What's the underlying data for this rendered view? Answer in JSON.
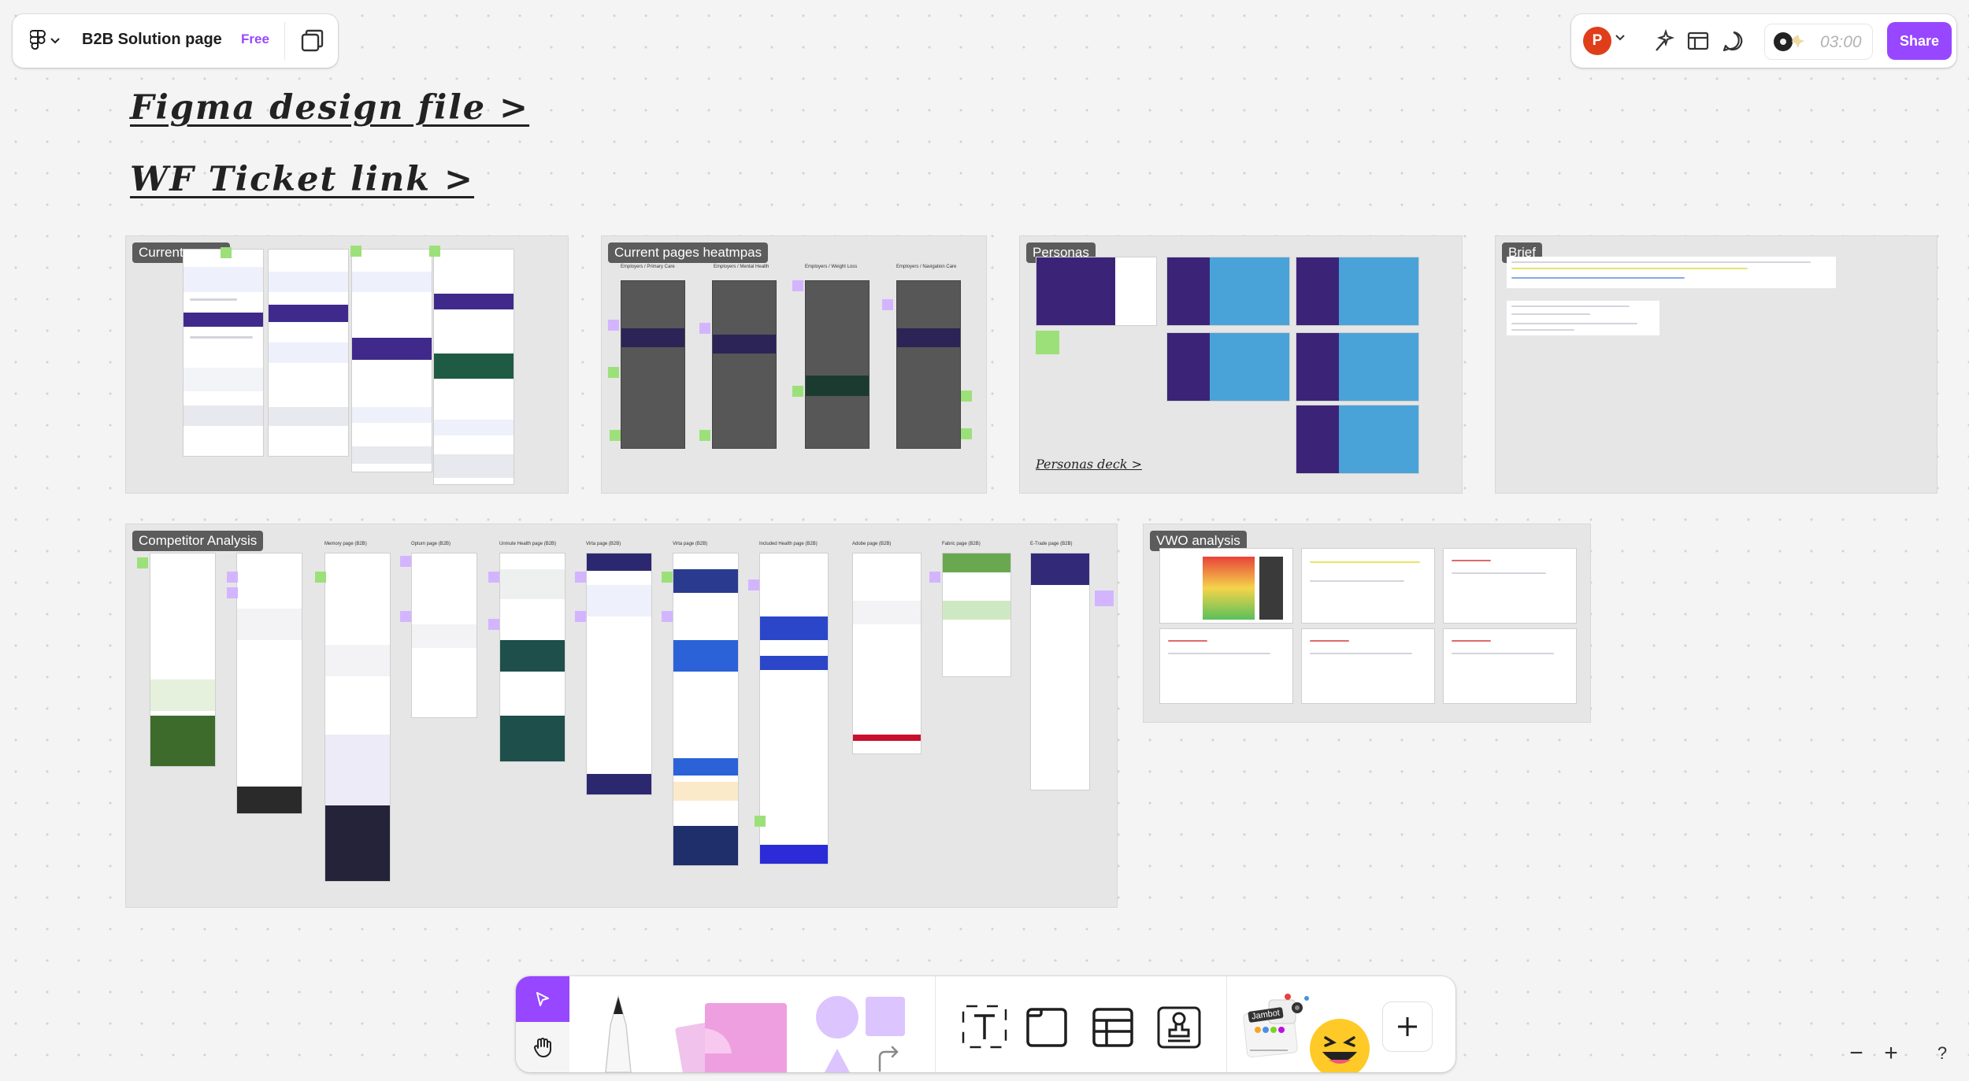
{
  "file": {
    "name": "B2B Solution page",
    "plan": "Free"
  },
  "toolbar_right": {
    "avatar_initial": "P",
    "timer": "03:00",
    "share_label": "Share"
  },
  "links": {
    "figma": "Figma design file >",
    "ticket": "WF Ticket link >"
  },
  "sections": {
    "current_pages": "Current pages",
    "heatmaps": "Current pages heatmpas",
    "personas": "Personas",
    "personas_link": "Personas deck >",
    "brief": "Brief",
    "competitor": "Competitor Analysis",
    "vwo": "VWO analysis"
  },
  "competitor_pages": [
    "Memory page (B2B)",
    "Optum page (B2B)",
    "Unmute Health page (B2B)",
    "Virta page (B2B)",
    "Virta page (B2B)",
    "Included Health page (B2B)",
    "Adobe page (B2B)",
    "Fabric page (B2B)",
    "E-Trade page (B2B)"
  ],
  "heatmap_captions": [
    "Employers / Primary Care",
    "Employers / Mental Health",
    "Employers / Weight Loss",
    "Employers / Navigation Care"
  ],
  "bottom_toolbar": {
    "jambot_label": "Jambot"
  },
  "zoom": {
    "minus": "−",
    "plus": "+"
  },
  "help": "?",
  "colors": {
    "accent": "#9747ff",
    "avatar": "#e03e1a",
    "section_bg": "#e6e6e6",
    "sticky_green": "#9ce07a",
    "sticky_purple": "#d3b5ff"
  },
  "icons": [
    "figma-logo-icon",
    "chevron-down-icon",
    "layout-panel-icon",
    "ai-sparkle-icon",
    "board-view-icon",
    "comment-icon",
    "music-icon",
    "move-cursor-icon",
    "hand-icon",
    "pencil-icon",
    "sticky-note-icon",
    "shape-icon",
    "connector-icon",
    "text-icon",
    "section-icon",
    "table-icon",
    "stamp-icon",
    "widgets-icon",
    "emoji-icon",
    "plus-icon"
  ]
}
